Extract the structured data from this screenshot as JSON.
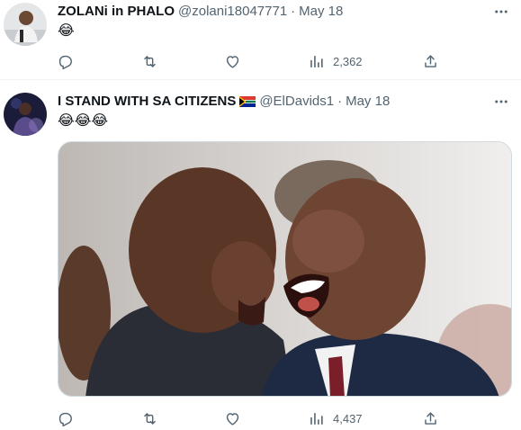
{
  "tweets": [
    {
      "display_name": "ZOLANi in PHALO",
      "handle": "@zolani18047771",
      "separator": "·",
      "date": "May 18",
      "text": "😂",
      "views": "2,362"
    },
    {
      "display_name": "I STAND WITH SA CITIZENS",
      "handle": "@ElDavids1",
      "separator": "·",
      "date": "May 18",
      "text": "😂😂😂",
      "views": "4,437"
    }
  ],
  "icons": {
    "more": "more-horizontal-icon",
    "reply": "reply-icon",
    "retweet": "retweet-icon",
    "like": "heart-icon",
    "views": "bar-chart-icon",
    "share": "share-icon",
    "flag": "south-africa-flag-icon"
  },
  "colors": {
    "text": "#0f1419",
    "secondary": "#536471",
    "divider": "#eff3f4"
  }
}
